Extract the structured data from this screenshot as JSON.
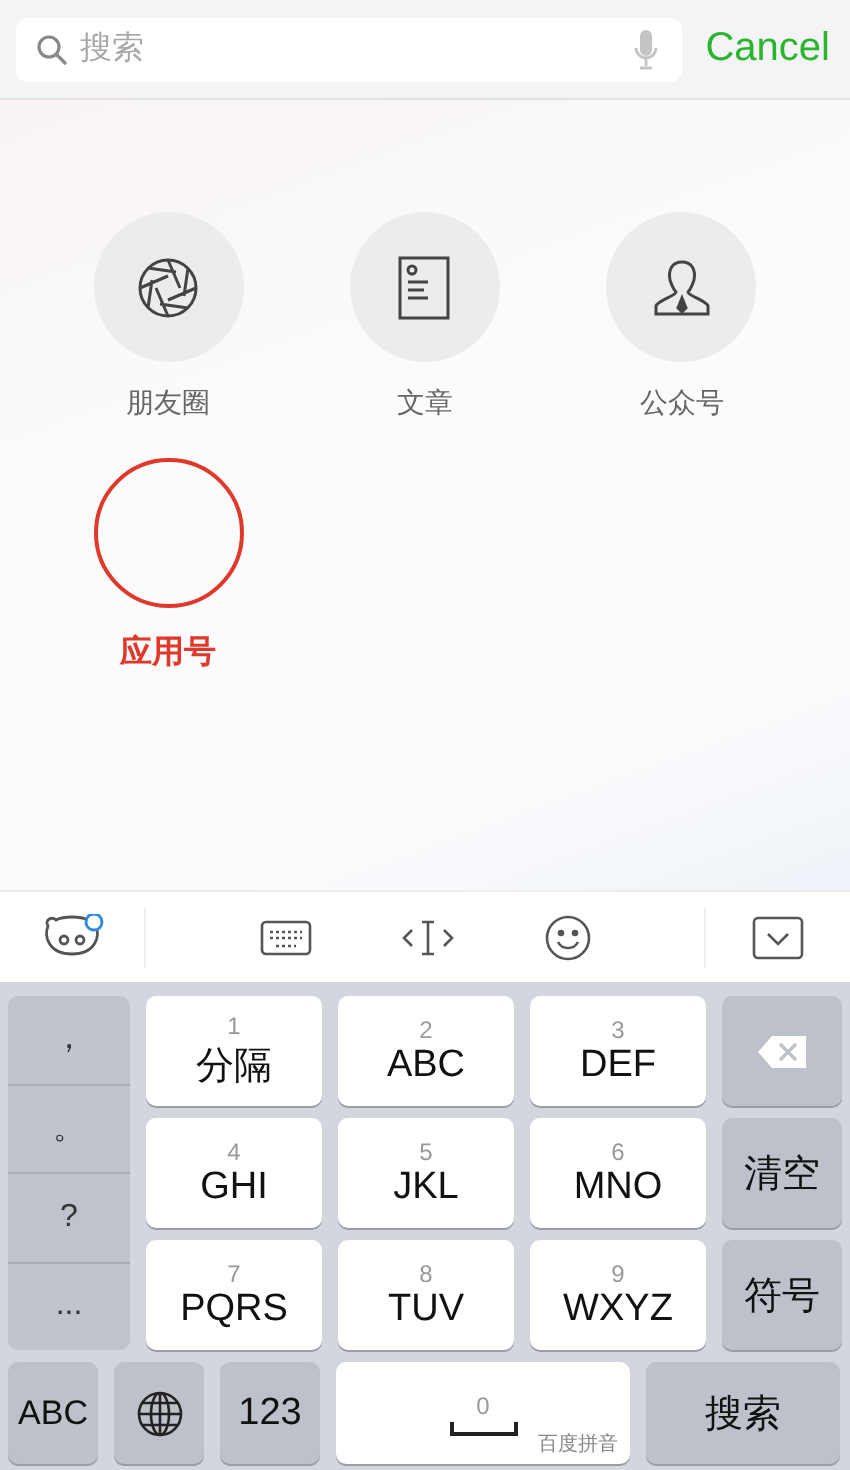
{
  "search": {
    "placeholder": "搜索",
    "cancel": "Cancel"
  },
  "categories": [
    {
      "label": "朋友圈",
      "kind": "shutter",
      "highlighted": false
    },
    {
      "label": "文章",
      "kind": "document",
      "highlighted": false
    },
    {
      "label": "公众号",
      "kind": "person",
      "highlighted": false
    },
    {
      "label": "应用号",
      "kind": "empty",
      "highlighted": true
    }
  ],
  "keyboard": {
    "punctuation": [
      "，",
      "。",
      "?",
      "..."
    ],
    "keys": [
      {
        "digit": "1",
        "letters": "分隔"
      },
      {
        "digit": "2",
        "letters": "ABC"
      },
      {
        "digit": "3",
        "letters": "DEF"
      },
      {
        "digit": "4",
        "letters": "GHI"
      },
      {
        "digit": "5",
        "letters": "JKL"
      },
      {
        "digit": "6",
        "letters": "MNO"
      },
      {
        "digit": "7",
        "letters": "PQRS"
      },
      {
        "digit": "8",
        "letters": "TUV"
      },
      {
        "digit": "9",
        "letters": "WXYZ"
      }
    ],
    "side_keys": [
      "清空",
      "符号"
    ],
    "bottom": {
      "abc": "ABC",
      "numbers": "123",
      "space_digit": "0",
      "space_brand": "百度拼音",
      "search": "搜索"
    }
  }
}
